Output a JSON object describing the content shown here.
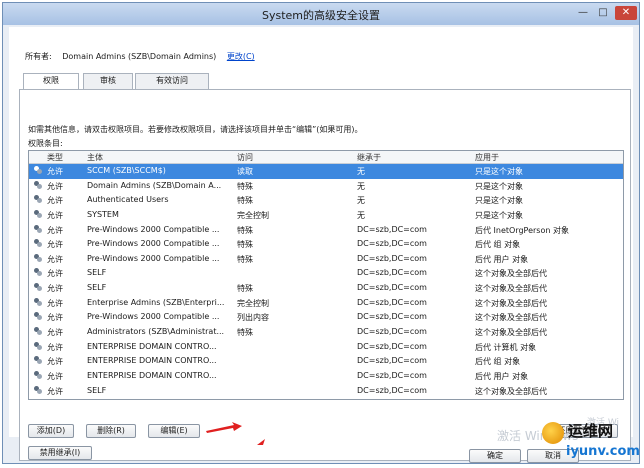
{
  "window": {
    "title": "System的高级安全设置",
    "min": "—",
    "max": "□",
    "close": "✕"
  },
  "owner": {
    "label": "所有者:",
    "value": "Domain Admins (SZB\\Domain Admins)",
    "change_link": "更改(C)"
  },
  "tabs": [
    {
      "label": "权限",
      "active": true
    },
    {
      "label": "审核",
      "active": false
    },
    {
      "label": "有效访问",
      "active": false
    }
  ],
  "info_text": "如需其他信息，请双击权限项目。若要修改权限项目，请选择该项目并单击“编辑”(如果可用)。",
  "entries_label": "权限条目:",
  "table": {
    "columns": [
      "类型",
      "主体",
      "访问",
      "继承于",
      "应用于"
    ],
    "rows": [
      {
        "type": "允许",
        "principal": "SCCM (SZB\\SCCM$)",
        "access": "读取",
        "inherited": "无",
        "applies": "只是这个对象",
        "selected": true
      },
      {
        "type": "允许",
        "principal": "Domain Admins (SZB\\Domain A...",
        "access": "特殊",
        "inherited": "无",
        "applies": "只是这个对象",
        "selected": false
      },
      {
        "type": "允许",
        "principal": "Authenticated Users",
        "access": "特殊",
        "inherited": "无",
        "applies": "只是这个对象",
        "selected": false
      },
      {
        "type": "允许",
        "principal": "SYSTEM",
        "access": "完全控制",
        "inherited": "无",
        "applies": "只是这个对象",
        "selected": false
      },
      {
        "type": "允许",
        "principal": "Pre-Windows 2000 Compatible ...",
        "access": "特殊",
        "inherited": "DC=szb,DC=com",
        "applies": "后代 InetOrgPerson 对象",
        "selected": false
      },
      {
        "type": "允许",
        "principal": "Pre-Windows 2000 Compatible ...",
        "access": "特殊",
        "inherited": "DC=szb,DC=com",
        "applies": "后代 组 对象",
        "selected": false
      },
      {
        "type": "允许",
        "principal": "Pre-Windows 2000 Compatible ...",
        "access": "特殊",
        "inherited": "DC=szb,DC=com",
        "applies": "后代 用户 对象",
        "selected": false
      },
      {
        "type": "允许",
        "principal": "SELF",
        "access": "",
        "inherited": "DC=szb,DC=com",
        "applies": "这个对象及全部后代",
        "selected": false
      },
      {
        "type": "允许",
        "principal": "SELF",
        "access": "特殊",
        "inherited": "DC=szb,DC=com",
        "applies": "这个对象及全部后代",
        "selected": false
      },
      {
        "type": "允许",
        "principal": "Enterprise Admins (SZB\\Enterpri...",
        "access": "完全控制",
        "inherited": "DC=szb,DC=com",
        "applies": "这个对象及全部后代",
        "selected": false
      },
      {
        "type": "允许",
        "principal": "Pre-Windows 2000 Compatible ...",
        "access": "列出内容",
        "inherited": "DC=szb,DC=com",
        "applies": "这个对象及全部后代",
        "selected": false
      },
      {
        "type": "允许",
        "principal": "Administrators (SZB\\Administrat...",
        "access": "特殊",
        "inherited": "DC=szb,DC=com",
        "applies": "这个对象及全部后代",
        "selected": false
      },
      {
        "type": "允许",
        "principal": "ENTERPRISE DOMAIN CONTRO...",
        "access": "",
        "inherited": "DC=szb,DC=com",
        "applies": "后代 计算机 对象",
        "selected": false
      },
      {
        "type": "允许",
        "principal": "ENTERPRISE DOMAIN CONTRO...",
        "access": "",
        "inherited": "DC=szb,DC=com",
        "applies": "后代 组 对象",
        "selected": false
      },
      {
        "type": "允许",
        "principal": "ENTERPRISE DOMAIN CONTRO...",
        "access": "",
        "inherited": "DC=szb,DC=com",
        "applies": "后代 用户 对象",
        "selected": false
      },
      {
        "type": "允许",
        "principal": "SELF",
        "access": "",
        "inherited": "DC=szb,DC=com",
        "applies": "这个对象及全部后代",
        "selected": false
      }
    ]
  },
  "buttons": {
    "add": "添加(D)",
    "remove": "删除(R)",
    "edit": "编辑(E)",
    "restore_defaults": "还原默认值(S)",
    "disable_inheritance": "禁用继承(I)",
    "ok": "确定",
    "cancel": "取消"
  },
  "overlay": {
    "activate_text": "激活 Windows",
    "activate_small": "激活 Wi",
    "watermark_name": "运维网",
    "watermark_url": "iyunv.com"
  },
  "colors": {
    "selection": "#3d88df",
    "arrow": "#e02020",
    "link": "#0044cc"
  },
  "icons": {
    "row_icon": "user-group-icon",
    "annotation": "red-arrow-icon"
  }
}
